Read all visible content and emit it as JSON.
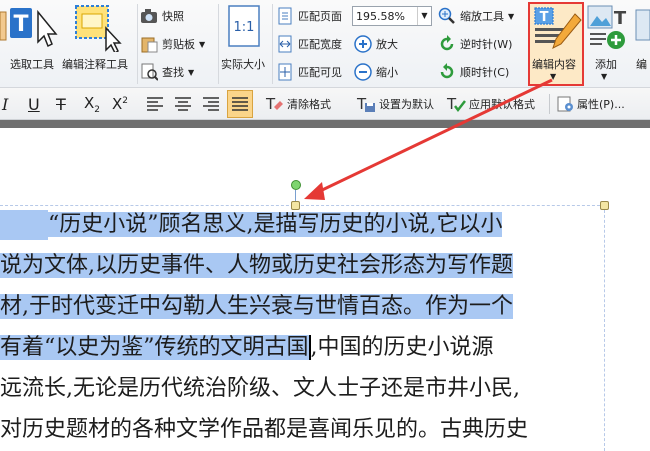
{
  "ribbon": {
    "select_text_label": "选取工具",
    "edit_annotation_label": "编辑注释工具",
    "snapshot_label": "快照",
    "clipboard_label": "剪贴板",
    "find_label": "查找",
    "actual_size_label": "实际大小",
    "fit_page_label": "匹配页面",
    "fit_width_label": "匹配宽度",
    "fit_visible_label": "匹配可见",
    "zoom_value": "195.58%",
    "zoom_tool_label": "缩放工具",
    "zoom_in_label": "放大",
    "zoom_out_label": "缩小",
    "rotate_ccw_label": "逆时针(W)",
    "rotate_cw_label": "顺时针(C)",
    "edit_content_label": "编辑内容",
    "add_label": "添加",
    "edit_cut_label": "编"
  },
  "format_bar": {
    "clear_format_label": "清除格式",
    "set_default_label": "设置为默认",
    "apply_default_label": "应用默认格式",
    "properties_label": "属性(P)..."
  },
  "document": {
    "lines": [
      {
        "sel": "“历史小说”顾名思义,是描写历史的小说,它以小",
        "rest": ""
      },
      {
        "sel": "说为文体,以历史事件、人物或历史社会形态为写作题",
        "rest": ""
      },
      {
        "sel": "材,于时代变迁中勾勒人生兴衰与世情百态。作为一个",
        "rest": ""
      },
      {
        "sel": "有着“以史为鉴”传统的文明古国",
        "rest": ",中国的历史小说源"
      },
      {
        "sel": "",
        "rest": "远流长,无论是历代统治阶级、文人士子还是市井小民,"
      },
      {
        "sel": "",
        "rest": "对历史题材的各种文学作品都是喜闻乐见的。古典历史"
      }
    ]
  },
  "colors": {
    "selection": "#a9c8f3",
    "highlight_border": "#e53935",
    "arrow": "#e53935"
  }
}
